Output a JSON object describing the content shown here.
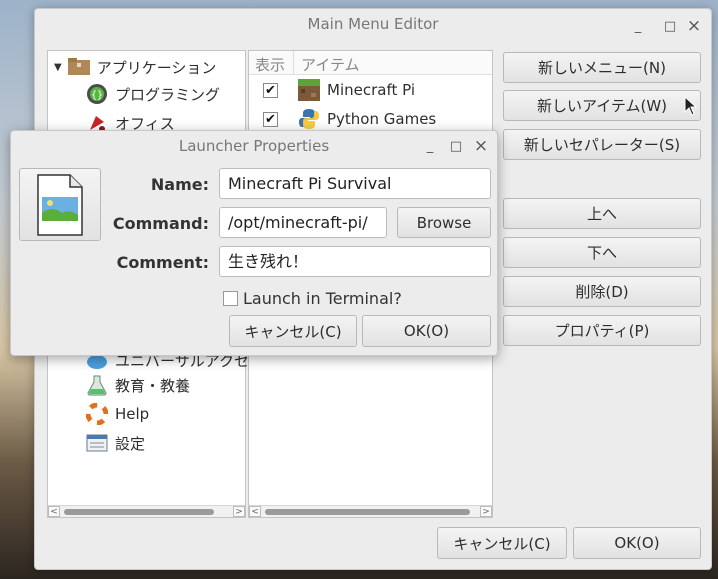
{
  "main_window": {
    "title": "Main Menu Editor",
    "controls": {
      "minimize": "_",
      "maximize": "□",
      "close": "×"
    },
    "tree": {
      "root_label": "アプリケーション",
      "items": [
        {
          "label": "プログラミング",
          "icon": "programming-icon"
        },
        {
          "label": "オフィス",
          "icon": "office-icon"
        },
        {
          "label": "ユニバーサルアクセス",
          "icon": "universal-access-icon"
        },
        {
          "label": "教育・教養",
          "icon": "education-icon"
        },
        {
          "label": "Help",
          "icon": "help-lifebuoy-icon"
        },
        {
          "label": "設定",
          "icon": "settings-icon"
        }
      ]
    },
    "items_list": {
      "col_show": "表示",
      "col_item": "アイテム",
      "rows": [
        {
          "checked": true,
          "label": "Minecraft Pi",
          "icon": "minecraft-icon"
        },
        {
          "checked": true,
          "label": "Python Games",
          "icon": "python-icon"
        }
      ]
    },
    "buttons": {
      "new_menu": "新しいメニュー(N)",
      "new_item": "新しいアイテム(W)",
      "new_separator": "新しいセパレーター(S)",
      "move_up": "上へ",
      "move_down": "下へ",
      "delete": "削除(D)",
      "properties": "プロパティ(P)",
      "cancel": "キャンセル(C)",
      "ok": "OK(O)"
    }
  },
  "dialog": {
    "title": "Launcher Properties",
    "controls": {
      "minimize": "_",
      "maximize": "□",
      "close": "×"
    },
    "name_label": "Name:",
    "name_value": "Minecraft Pi Survival",
    "command_label": "Command:",
    "command_value": "/opt/minecraft-pi/",
    "browse": "Browse",
    "comment_label": "Comment:",
    "comment_value": "生き残れ！",
    "terminal_checkbox_label": "Launch in Terminal?",
    "terminal_checked": false,
    "cancel": "キャンセル(C)",
    "ok": "OK(O)"
  }
}
